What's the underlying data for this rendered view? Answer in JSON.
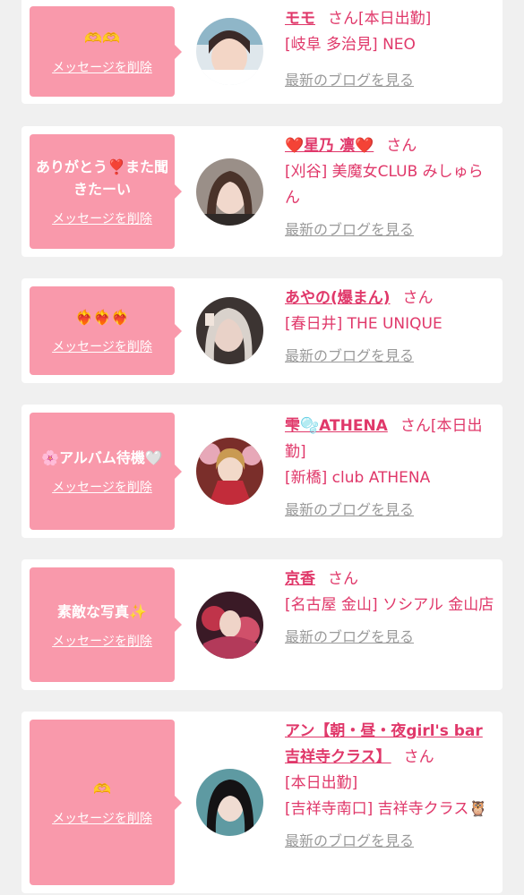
{
  "colors": {
    "bubble": "#f999ab",
    "accent": "#e0386a",
    "link_gray": "#9a9a9a",
    "background": "#f0f0f0"
  },
  "messages": [
    {
      "message": "🫶🫶",
      "delete_label": "メッセージを削除",
      "name": "モモ",
      "san": "さん",
      "status": "[本日出勤]",
      "shop": "[岐阜 多治見] NEO",
      "blog_label": "最新のブログを見る",
      "avatar_icon": "profile-photo"
    },
    {
      "message": "ありがとう❣️また聞きたーい",
      "delete_label": "メッセージを削除",
      "name": "❤️星乃 凛❤️",
      "san": "さん",
      "status": "",
      "shop": "[刈谷] 美魔女CLUB みしゅらん",
      "blog_label": "最新のブログを見る",
      "avatar_icon": "profile-photo"
    },
    {
      "message": "❤️‍🔥❤️‍🔥❤️‍🔥",
      "delete_label": "メッセージを削除",
      "name": "あやの(爆まん)",
      "san": "さん",
      "status": "",
      "shop": "[春日井] THE UNIQUE",
      "blog_label": "最新のブログを見る",
      "avatar_icon": "profile-photo"
    },
    {
      "message": "🌸アルバム待機🤍",
      "delete_label": "メッセージを削除",
      "name": "雫🫧ATHENA",
      "san": "さん",
      "status": "[本日出勤]",
      "shop": "[新橋] club ATHENA",
      "blog_label": "最新のブログを見る",
      "avatar_icon": "profile-photo"
    },
    {
      "message": "素敵な写真✨",
      "delete_label": "メッセージを削除",
      "name": "京香",
      "san": "さん",
      "status": "",
      "shop": "[名古屋 金山] ソシアル 金山店",
      "blog_label": "最新のブログを見る",
      "avatar_icon": "profile-photo"
    },
    {
      "message": "🫶",
      "delete_label": "メッセージを削除",
      "name": "アン【朝・昼・夜girl's bar吉祥寺クラス】",
      "san": "さん",
      "status": "[本日出勤]",
      "shop": "[吉祥寺南口] 吉祥寺クラス🦉",
      "blog_label": "最新のブログを見る",
      "avatar_icon": "profile-photo"
    }
  ]
}
